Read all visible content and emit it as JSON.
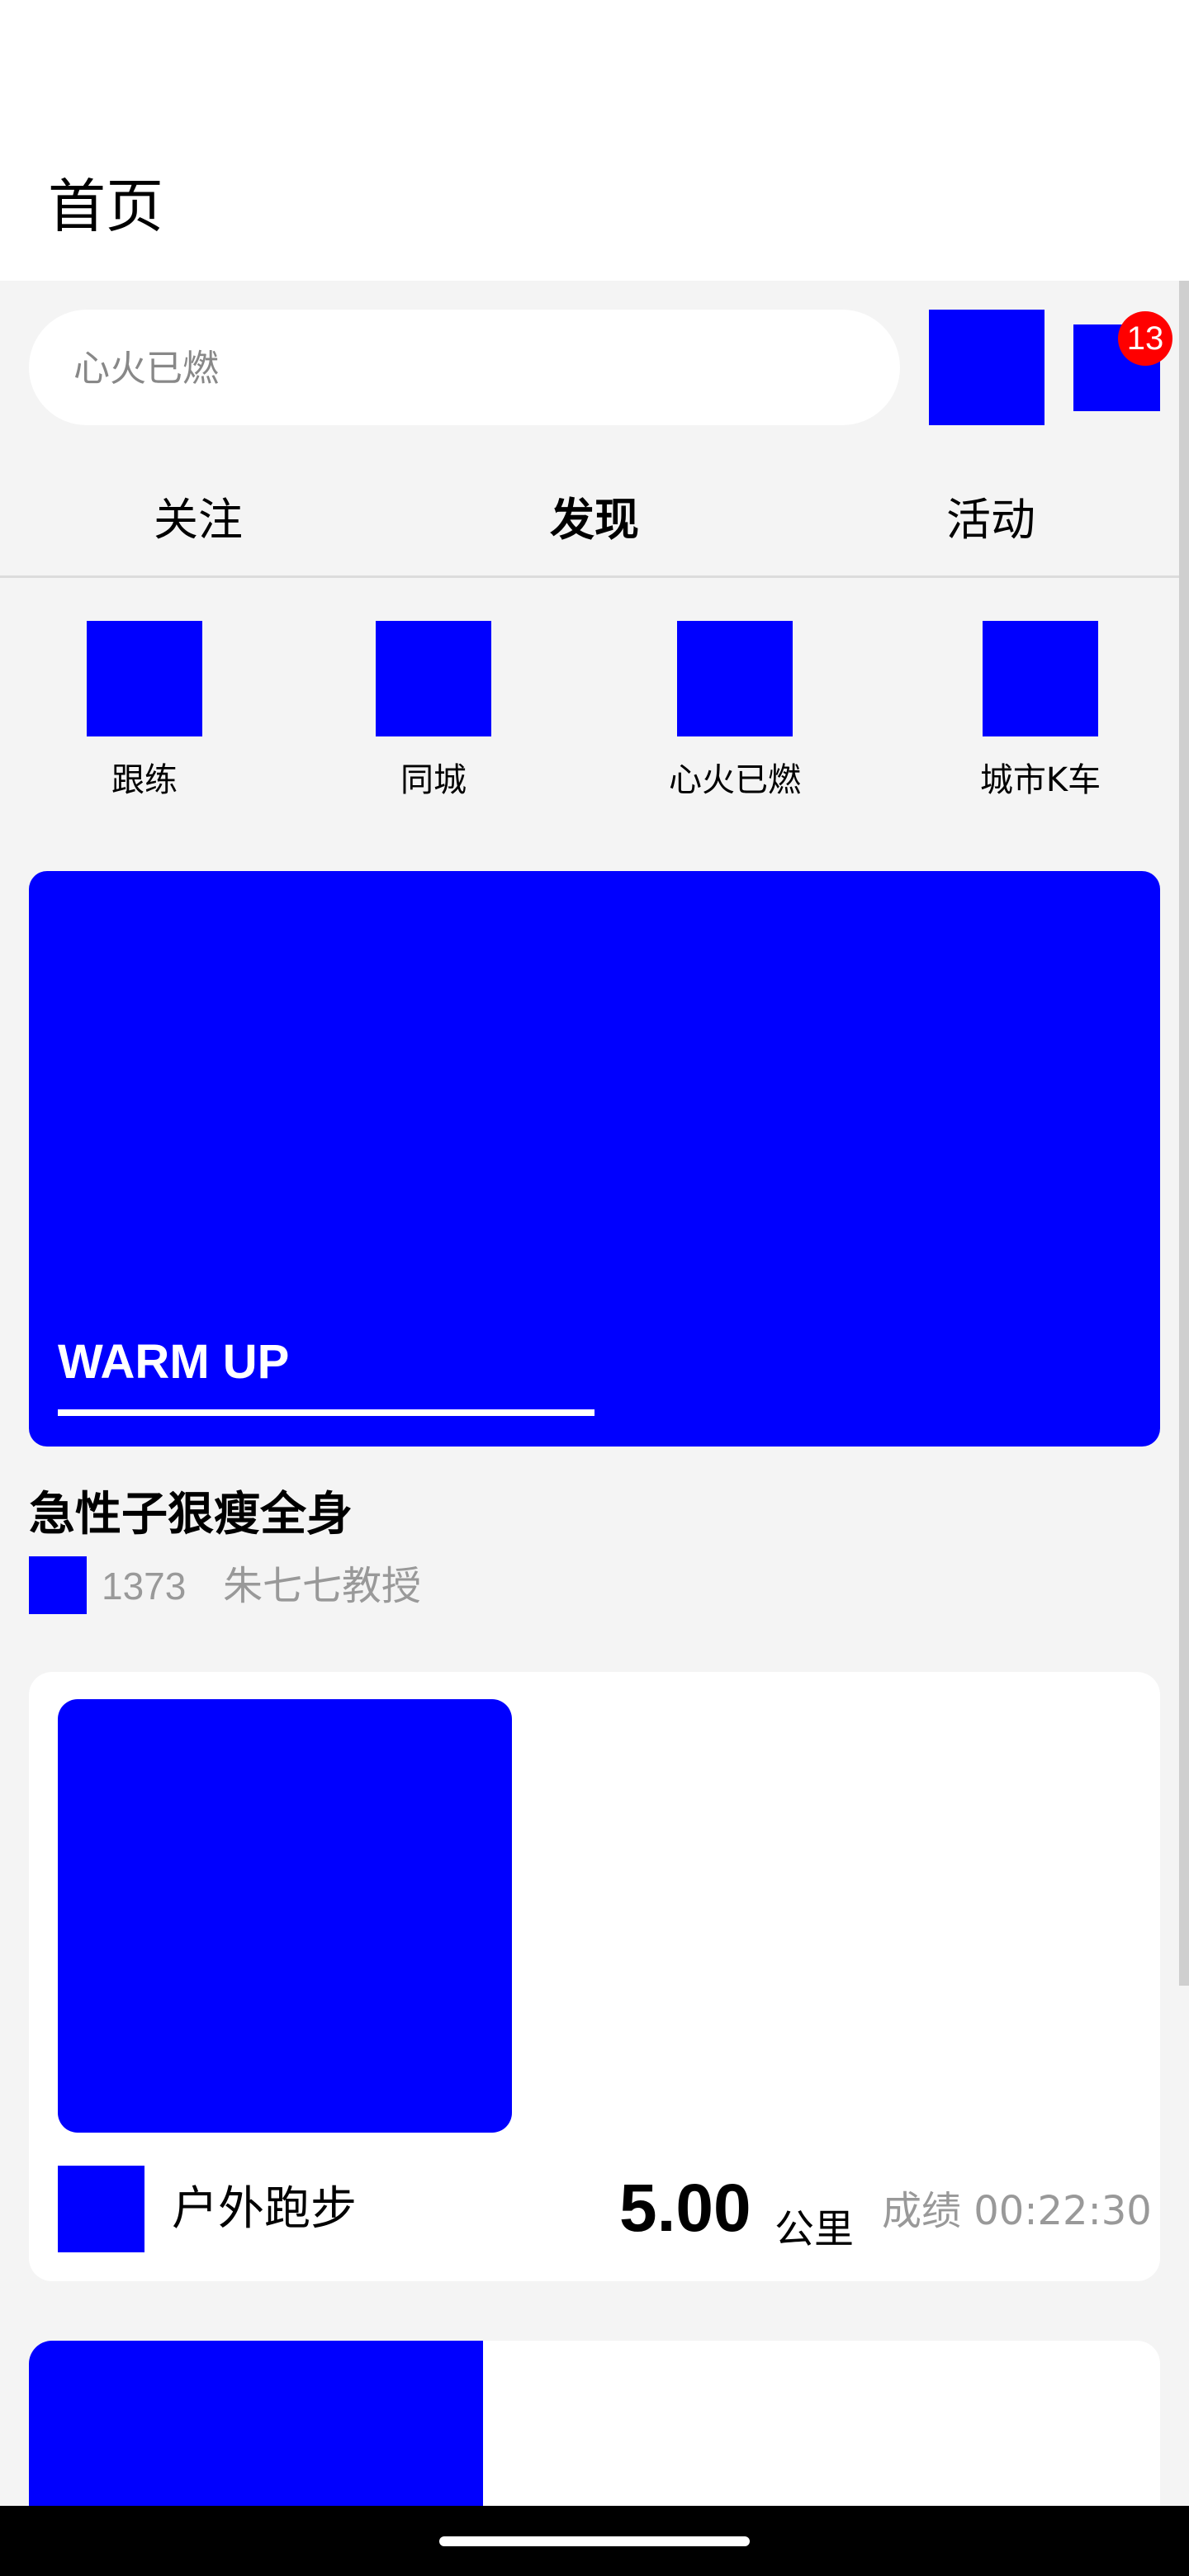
{
  "header": {
    "title": "首页"
  },
  "search": {
    "placeholder": "心火已燃"
  },
  "notifications": {
    "badge_count": "13"
  },
  "tabs": [
    {
      "label": "关注",
      "selected": false
    },
    {
      "label": "发现",
      "selected": true
    },
    {
      "label": "活动",
      "selected": false
    }
  ],
  "categories": [
    {
      "label": "跟练"
    },
    {
      "label": "同城"
    },
    {
      "label": "心火已燃"
    },
    {
      "label": "城市K车"
    }
  ],
  "banner": {
    "text": "WARM UP"
  },
  "course": {
    "title": "急性子狠瘦全身",
    "count": "1373",
    "author": "朱七七教授"
  },
  "record": {
    "type": "户外跑步",
    "distance": "5.00",
    "unit": "公里",
    "time": "成绩 00:22:30"
  },
  "colors": {
    "placeholder_image": "#0000ff",
    "badge": "#ff0000",
    "background": "#f4f4f4"
  }
}
